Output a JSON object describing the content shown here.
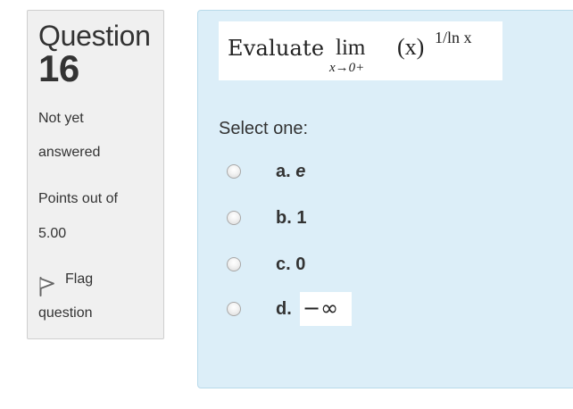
{
  "info": {
    "question_word": "Question",
    "question_number": "16",
    "state_line1": "Not yet",
    "state_line2": "answered",
    "points_line1": "Points out of",
    "points_line2": "5.00",
    "flag_line1": "Flag",
    "flag_line2": "question",
    "flag_icon": "flag-icon"
  },
  "question": {
    "evaluate": "Evaluate",
    "lim": "lim",
    "lim_sub": "x→0+",
    "expr": "(x)",
    "exponent": "1/ln x"
  },
  "prompt": "Select one:",
  "options": [
    {
      "letter": "a.",
      "value": "e"
    },
    {
      "letter": "b.",
      "value": "1"
    },
    {
      "letter": "c.",
      "value": "0"
    },
    {
      "letter": "d.",
      "value": "−∞"
    }
  ],
  "colors": {
    "info_bg": "#f0f0f0",
    "content_bg": "#dceef8",
    "content_border": "#b8daea"
  }
}
